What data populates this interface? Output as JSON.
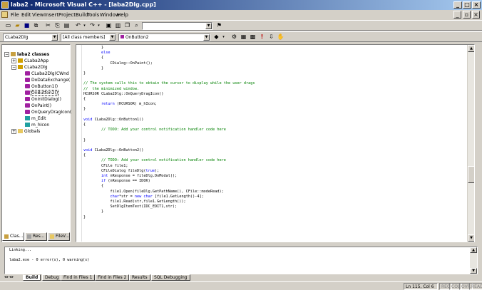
{
  "window": {
    "title": "laba2 - Microsoft Visual C++ - [laba2Dlg.cpp]"
  },
  "menu": [
    "File",
    "Edit",
    "View",
    "Insert",
    "Project",
    "Build",
    "Tools",
    "Window",
    "Help"
  ],
  "toolbar": {
    "find_combo_value": "",
    "class_combo": "CLaba2Dlg",
    "filter_combo": "[All class members]",
    "member_combo": "OnButton2"
  },
  "class_view": {
    "root": "laba2 classes",
    "items": [
      {
        "label": "CLaba2App",
        "kind": "class"
      },
      {
        "label": "CLaba2Dlg",
        "kind": "class"
      },
      {
        "label": "CLaba2Dlg(CWnd",
        "kind": "method"
      },
      {
        "label": "DoDataExchange(",
        "kind": "method"
      },
      {
        "label": "OnButton1()",
        "kind": "method"
      },
      {
        "label": "OnButton2()",
        "kind": "method"
      },
      {
        "label": "OnInitDialog()",
        "kind": "method"
      },
      {
        "label": "OnPaint()",
        "kind": "method"
      },
      {
        "label": "OnQueryDragIcon(",
        "kind": "method"
      },
      {
        "label": "m_Edit",
        "kind": "var"
      },
      {
        "label": "m_hIcon",
        "kind": "var"
      },
      {
        "label": "Globals",
        "kind": "folder"
      }
    ],
    "tabs": [
      "Clas...",
      "Res...",
      "FileV..."
    ]
  },
  "code_lines": [
    "        }",
    "        else",
    "        {",
    "            CDialog::OnPaint();",
    "        }",
    "}",
    "",
    "// The system calls this to obtain the cursor to display while the user drags",
    "//  the minimized window.",
    "HCURSOR CLaba2Dlg::OnQueryDragIcon()",
    "{",
    "        return (HCURSOR) m_hIcon;",
    "}",
    "",
    "void CLaba2Dlg::OnButton1()",
    "{",
    "        // TODO: Add your control notification handler code here",
    "",
    "}",
    "",
    "void CLaba2Dlg::OnButton2()",
    "{",
    "        // TODO: Add your control notification handler code here",
    "        CFile file1;",
    "        CFileDialog fileDlg(true);",
    "        int nResponse = fileDlg.DoModal();",
    "        if (nResponse == IDOK)",
    "        {",
    "            file1.Open(fileDlg.GetPathName(), CFile::modeRead);",
    "            char*str = new char [file1.GetLength()-4];",
    "            file1.Read(str,file1.GetLength());",
    "            SetDlgItemText(IDC_EDIT1,str);",
    "        }",
    "}"
  ],
  "output": {
    "lines": [
      "Linking...",
      "",
      "laba2.exe - 0 error(s), 0 warning(s)"
    ],
    "tabs": [
      "Build",
      "Debug",
      "Find in Files 1",
      "Find in Files 2",
      "Results",
      "SQL Debugging"
    ],
    "active_tab": "Build"
  },
  "status": {
    "position": "Ln 115, Col 6",
    "indicators": [
      "REC",
      "COL",
      "OVR",
      "READ"
    ]
  }
}
